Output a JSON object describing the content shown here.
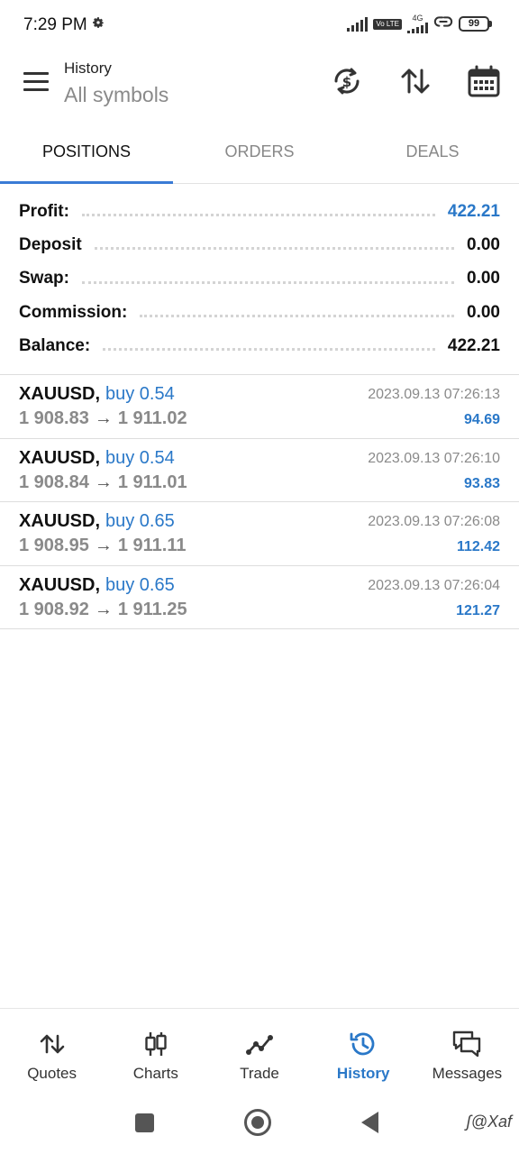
{
  "status_bar": {
    "time": "7:29 PM",
    "volte": "Vo LTE",
    "network": "4G",
    "battery": "99"
  },
  "header": {
    "title": "History",
    "subtitle": "All symbols"
  },
  "tabs": [
    {
      "label": "POSITIONS",
      "active": true
    },
    {
      "label": "ORDERS",
      "active": false
    },
    {
      "label": "DEALS",
      "active": false
    }
  ],
  "summary": [
    {
      "label": "Profit:",
      "value": "422.21",
      "highlight": true
    },
    {
      "label": "Deposit",
      "value": "0.00",
      "highlight": false
    },
    {
      "label": "Swap:",
      "value": "0.00",
      "highlight": false
    },
    {
      "label": "Commission:",
      "value": "0.00",
      "highlight": false
    },
    {
      "label": "Balance:",
      "value": "422.21",
      "highlight": false
    }
  ],
  "deals": [
    {
      "symbol": "XAUUSD",
      "side": "buy 0.54",
      "open_price": "1 908.83",
      "close_price": "1 911.02",
      "time": "2023.09.13 07:26:13",
      "profit": "94.69"
    },
    {
      "symbol": "XAUUSD",
      "side": "buy 0.54",
      "open_price": "1 908.84",
      "close_price": "1 911.01",
      "time": "2023.09.13 07:26:10",
      "profit": "93.83"
    },
    {
      "symbol": "XAUUSD",
      "side": "buy 0.65",
      "open_price": "1 908.95",
      "close_price": "1 911.11",
      "time": "2023.09.13 07:26:08",
      "profit": "112.42"
    },
    {
      "symbol": "XAUUSD",
      "side": "buy 0.65",
      "open_price": "1 908.92",
      "close_price": "1 911.25",
      "time": "2023.09.13 07:26:04",
      "profit": "121.27"
    }
  ],
  "bottom_nav": [
    {
      "label": "Quotes",
      "icon": "quotes-arrows-icon",
      "active": false
    },
    {
      "label": "Charts",
      "icon": "candlestick-icon",
      "active": false
    },
    {
      "label": "Trade",
      "icon": "trade-line-icon",
      "active": false
    },
    {
      "label": "History",
      "icon": "history-clock-icon",
      "active": true
    },
    {
      "label": "Messages",
      "icon": "messages-icon",
      "active": false
    }
  ],
  "watermark": "ʃ@Xaf",
  "colors": {
    "accent": "#2a78c8",
    "tab_indicator": "#3a7bd5",
    "muted": "#8a8a8a"
  }
}
